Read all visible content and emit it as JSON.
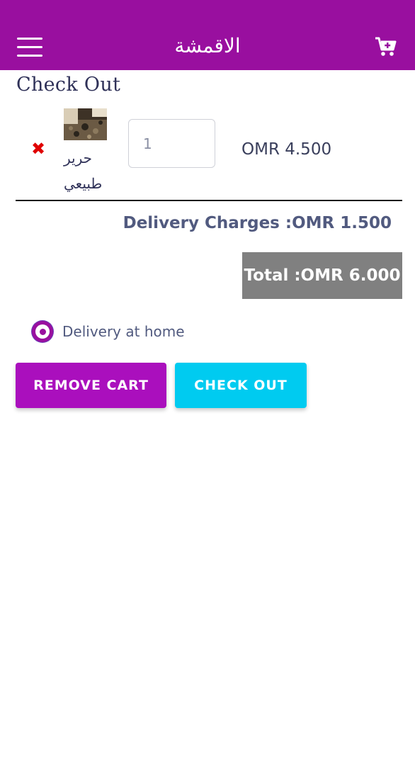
{
  "header": {
    "title": "الاقمشة",
    "menu_icon": "hamburger-menu-icon",
    "cart_icon": "cart-plus-icon",
    "background": "#990f9f"
  },
  "page": {
    "title": "Check Out"
  },
  "cart": {
    "items": [
      {
        "name_line1": "حرير",
        "name_line2": "طبيعي",
        "quantity": "1",
        "price": "OMR 4.500",
        "remove_icon": "close-x-icon"
      }
    ]
  },
  "summary": {
    "delivery_charges": "Delivery Charges :OMR 1.500",
    "total": "Total :OMR 6.000"
  },
  "delivery_option": {
    "label": "Delivery at home",
    "selected": true
  },
  "buttons": {
    "remove_cart": "REMOVE CART",
    "check_out": "CHECK OUT"
  },
  "colors": {
    "primary": "#990f9f",
    "remove_button": "#aa0fbd",
    "checkout_button": "#00cbf0",
    "total_box": "#808080",
    "remove_icon": "#e00000"
  }
}
